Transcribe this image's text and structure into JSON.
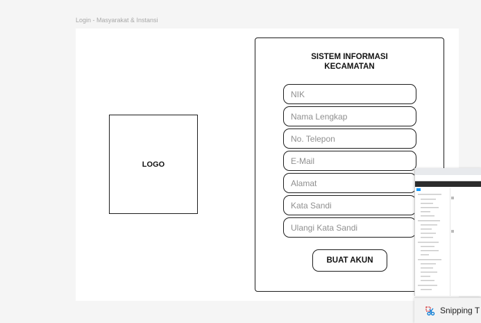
{
  "canvas": {
    "frame_label": "Login - Masyarakat & Instansi"
  },
  "logo": {
    "label": "LOGO"
  },
  "form": {
    "title_line1": "SISTEM INFORMASI",
    "title_line2": "KECAMATAN",
    "fields": [
      {
        "placeholder": "NIK"
      },
      {
        "placeholder": "Nama Lengkap"
      },
      {
        "placeholder": "No. Telepon"
      },
      {
        "placeholder": "E-Mail"
      },
      {
        "placeholder": "Alamat"
      },
      {
        "placeholder": "Kata Sandi"
      },
      {
        "placeholder": "Ulangi Kata Sandi"
      }
    ],
    "submit_label": "BUAT AKUN"
  },
  "snipping": {
    "app_name": "Snipping T",
    "icon": "scissors-icon"
  },
  "colors": {
    "canvas_bg": "#f5f5f5",
    "frame_bg": "#ffffff",
    "border": "#1a1a1a",
    "placeholder": "#8f8f8f",
    "accent": "#0d99ff"
  }
}
